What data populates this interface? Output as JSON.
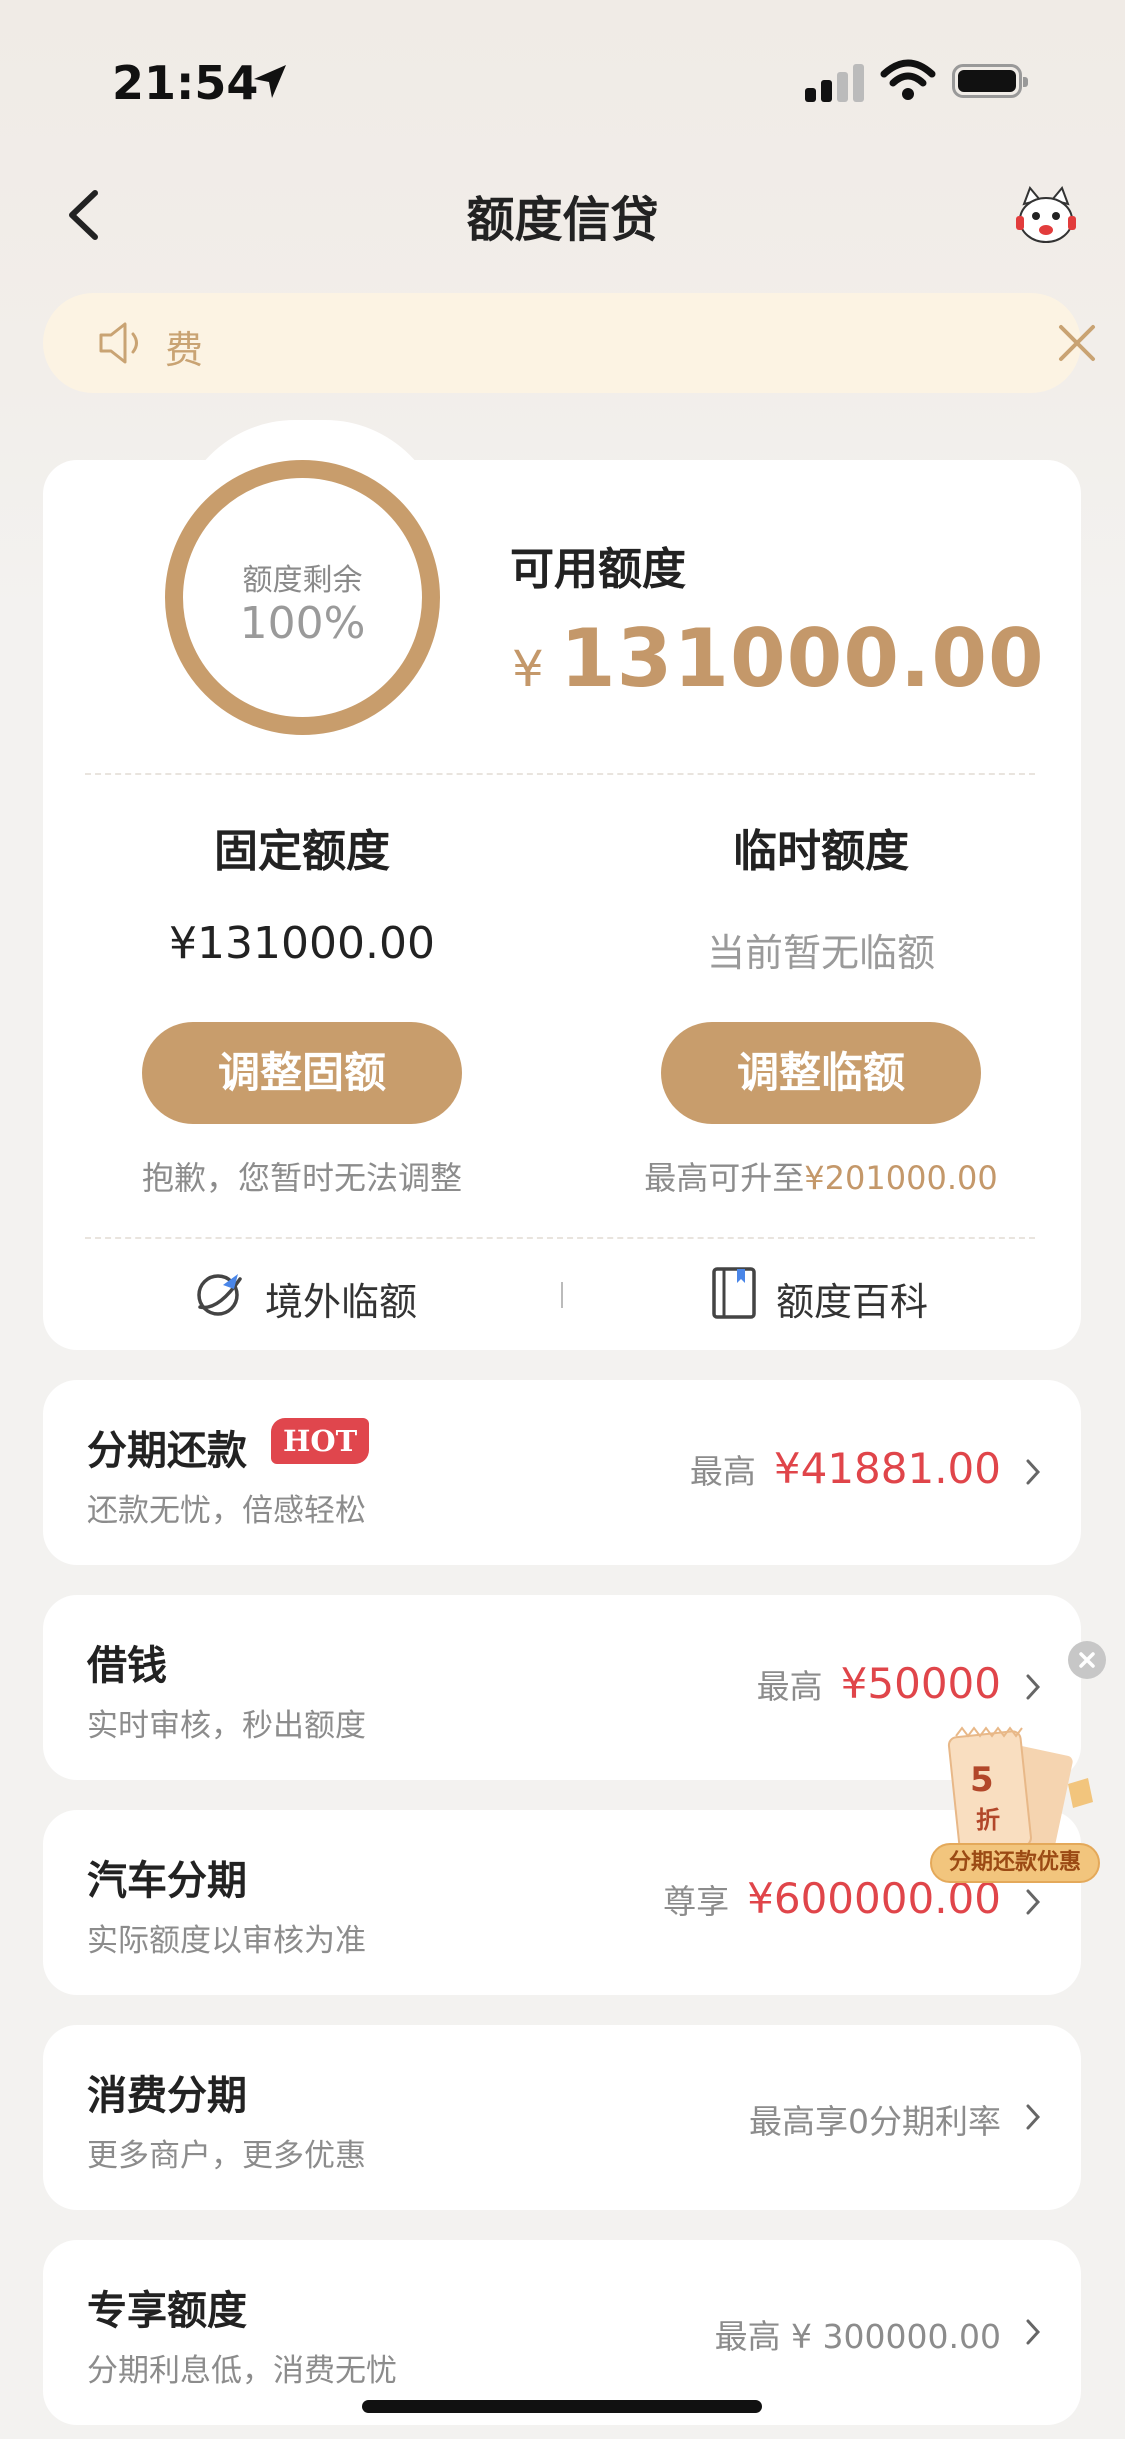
{
  "status_bar": {
    "time": "21:54"
  },
  "nav": {
    "title": "额度信贷",
    "back_icon": "chevron-left-icon",
    "service_icon": "mascot-service-icon"
  },
  "notice": {
    "text": "费",
    "icon": "speaker-icon",
    "close_icon": "close-icon"
  },
  "quota": {
    "ring_label": "额度剩余",
    "ring_percent": "100%",
    "ring_fraction": 1.0,
    "available_label": "可用额度",
    "currency": "¥",
    "available_value": "131000.00",
    "fixed": {
      "title": "固定额度",
      "value": "¥131000.00",
      "button": "调整固额",
      "note": "抱歉，您暂时无法调整"
    },
    "temporary": {
      "title": "临时额度",
      "value": "当前暂无临额",
      "button": "调整临额",
      "note_prefix": "最高可升至",
      "note_amount": "¥201000.00"
    },
    "links": [
      {
        "label": "境外临额",
        "icon": "plane-globe-icon"
      },
      {
        "label": "额度百科",
        "icon": "book-icon"
      }
    ]
  },
  "services": [
    {
      "title": "分期还款",
      "badge": "HOT",
      "subtitle": "还款无忧，倍感轻松",
      "prefix": "最高",
      "amount": "¥41881.00"
    },
    {
      "title": "借钱",
      "subtitle": "实时审核，秒出额度",
      "prefix": "最高",
      "amount": "¥50000"
    },
    {
      "title": "汽车分期",
      "subtitle": "实际额度以审核为准",
      "prefix": "尊享",
      "amount": "¥600000.00"
    },
    {
      "title": "消费分期",
      "subtitle": "更多商户，更多优惠",
      "prefix": "最高享0分期利率",
      "amount": ""
    },
    {
      "title": "专享额度",
      "subtitle": "分期利息低，消费无忧",
      "prefix": "最高 ¥ 300000.00",
      "amount": ""
    }
  ],
  "promo": {
    "label": "分期还款优惠",
    "discount": "5",
    "unit": "折"
  },
  "colors": {
    "gold": "#c89d6c",
    "red": "#e0454a",
    "notice_bg": "#fcf3e3"
  }
}
